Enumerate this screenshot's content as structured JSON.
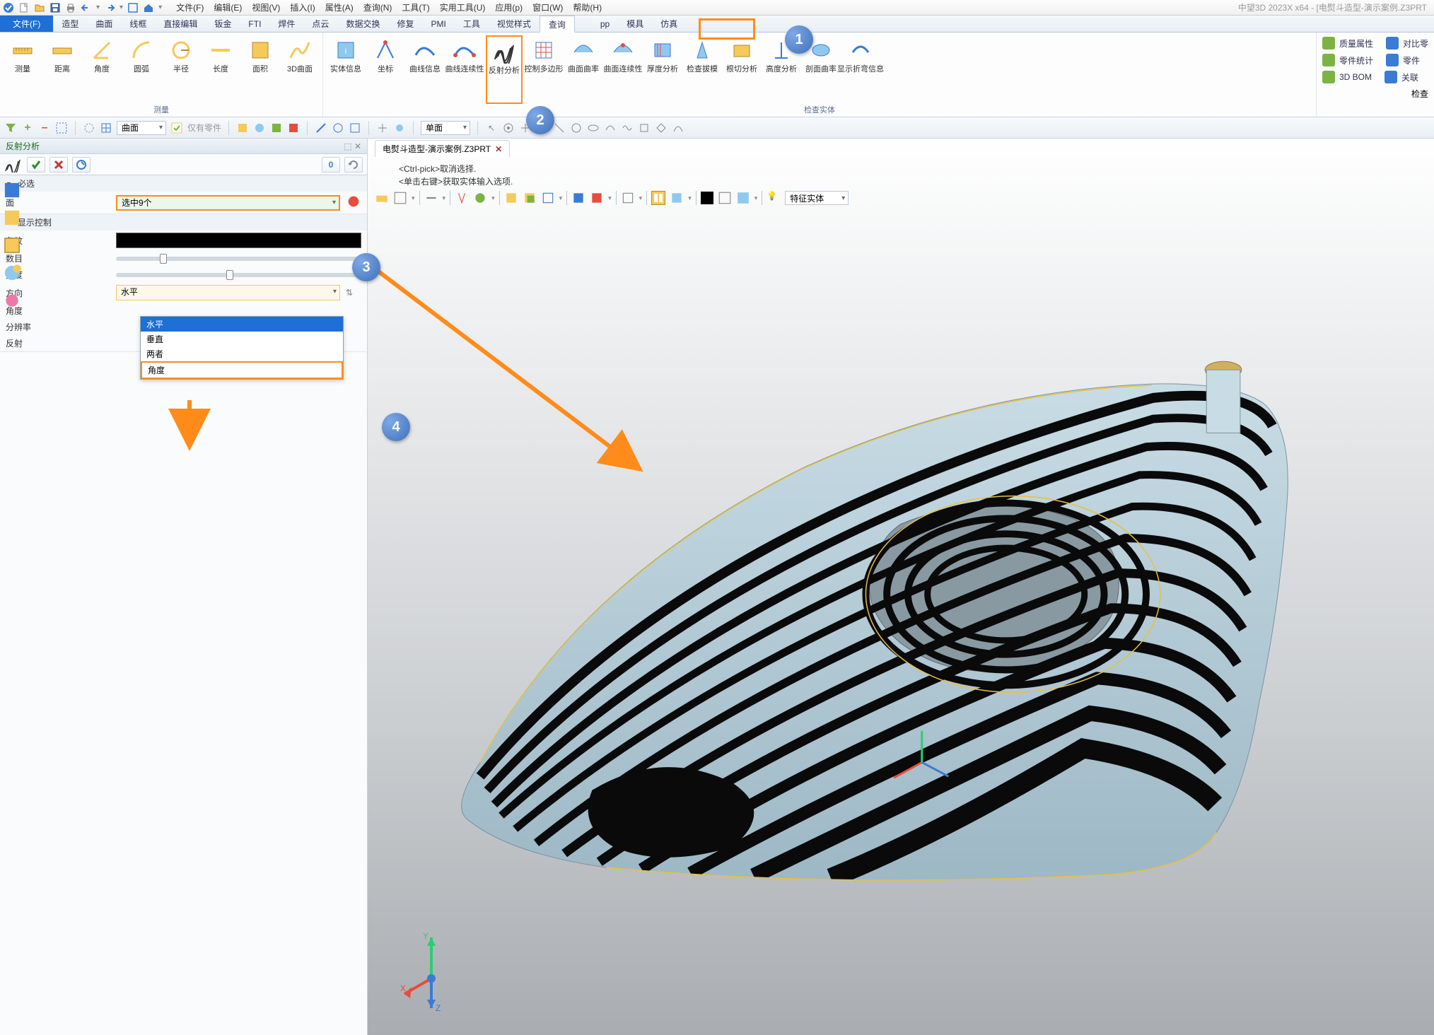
{
  "app": {
    "title": "中望3D 2023X x64 - [电熨斗造型-演示案例.Z3PRT"
  },
  "menubar": [
    "文件(F)",
    "编辑(E)",
    "视图(V)",
    "插入(I)",
    "属性(A)",
    "查询(N)",
    "工具(T)",
    "实用工具(U)",
    "应用(p)",
    "窗口(W)",
    "帮助(H)"
  ],
  "ribbon_tabs": {
    "file": "文件(F)",
    "items": [
      "造型",
      "曲面",
      "线框",
      "直接编辑",
      "钣金",
      "FTI",
      "焊件",
      "点云",
      "数据交换",
      "修复",
      "PMI",
      "工具",
      "视觉样式",
      "查询",
      "",
      "pp",
      "模具",
      "仿真"
    ],
    "active": "查询"
  },
  "ribbon": {
    "measure": {
      "label": "测量",
      "btns": [
        "测量",
        "距离",
        "角度",
        "圆弧",
        "半径",
        "长度",
        "面积",
        "3D曲面"
      ]
    },
    "entity": {
      "btns": [
        "实体信息",
        "坐标",
        "曲线信息",
        "曲线连续性",
        "反射分析",
        "控制多边形",
        "曲面曲率",
        "曲面连续性",
        "厚度分析",
        "检查拔模",
        "根切分析",
        "高度分析",
        "剖面曲率",
        "显示折弯信息"
      ],
      "label": "检查实体"
    },
    "side": [
      "质量属性",
      "零件统计",
      "3D BOM",
      "对比零",
      "零件",
      "关联",
      "检查"
    ]
  },
  "qtb": {
    "filter": "曲面",
    "only_parts": "仅有零件",
    "shade": "单面"
  },
  "panel": {
    "title": "反射分析",
    "required": "必选",
    "face": {
      "label": "面",
      "value": "选中9个"
    },
    "display": "显示控制",
    "stripe": "条纹",
    "count": "数目",
    "width": "宽度",
    "direction": {
      "label": "方向",
      "value": "水平",
      "options": [
        "水平",
        "垂直",
        "两者",
        "角度"
      ]
    },
    "angle": "角度",
    "resolution": "分辨率",
    "reflect": "反射"
  },
  "viewport": {
    "tab": "电熨斗造型-演示案例.Z3PRT",
    "hint1": "<Ctrl-pick>取消选择.",
    "hint2": "<单击右键>获取实体输入选项.",
    "special": "特征实体"
  },
  "callouts": {
    "c1": "1",
    "c2": "2",
    "c3": "3",
    "c4": "4"
  },
  "axes": {
    "x": "X",
    "y": "Y",
    "z": "Z"
  }
}
